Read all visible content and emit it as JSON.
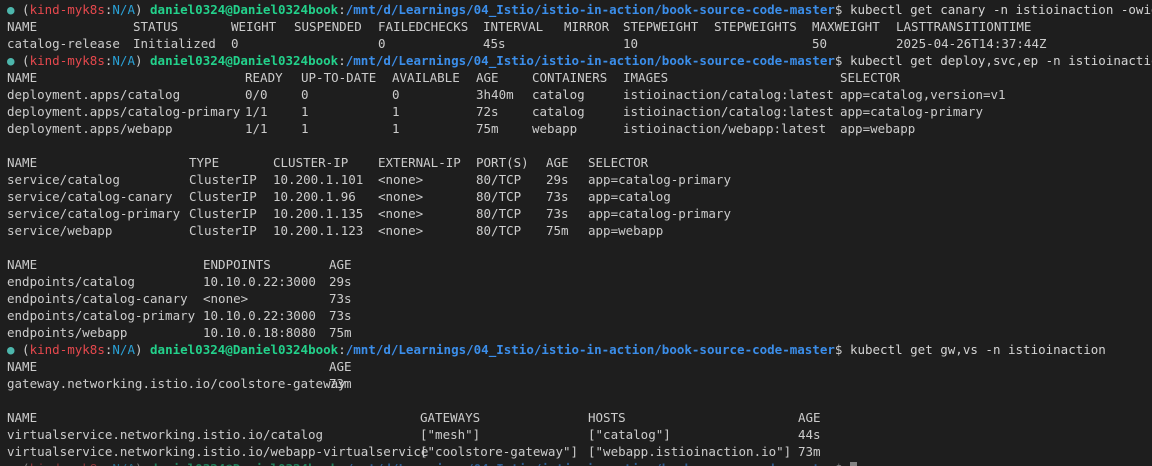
{
  "colors": {
    "background": "#1e1e1e",
    "text": "#cccccc",
    "prompt_dot": "#4db6ac",
    "context": "#e5484d",
    "namespace": "#2aa1d6",
    "user": "#23d18b",
    "path": "#3b8eea"
  },
  "prompt": {
    "dot": "●",
    "open": " (",
    "context": "kind-myk8s",
    "sep": ":",
    "namespace": "N/A",
    "close": ") ",
    "user": "daniel0324@Daniel0324book",
    "colon": ":",
    "path": "/mnt/d/Learnings/04_Istio/istio-in-action/book-source-code-master",
    "dollar": "$ "
  },
  "commands": [
    "kubectl get canary -n istioinaction -owide",
    "kubectl get deploy,svc,ep -n istioinaction -o wide",
    "kubectl get gw,vs -n istioinaction",
    ""
  ],
  "tables": [
    {
      "id": "canary",
      "header": [
        "NAME",
        "STATUS",
        "WEIGHT",
        "SUSPENDED",
        "FAILEDCHECKS",
        "INTERVAL",
        "MIRROR",
        "STEPWEIGHT",
        "STEPWEIGHTS",
        "MAXWEIGHT",
        "LASTTRANSITIONTIME"
      ],
      "rows": [
        [
          "catalog-release",
          "Initialized",
          "0",
          "",
          "0",
          "45s",
          "",
          "10",
          "",
          "50",
          "2025-04-26T14:37:44Z"
        ]
      ]
    },
    {
      "id": "deploy",
      "header": [
        "NAME",
        "READY",
        "UP-TO-DATE",
        "AVAILABLE",
        "AGE",
        "CONTAINERS",
        "IMAGES",
        "SELECTOR"
      ],
      "rows": [
        [
          "deployment.apps/catalog",
          "0/0",
          "0",
          "0",
          "3h40m",
          "catalog",
          "istioinaction/catalog:latest",
          "app=catalog,version=v1"
        ],
        [
          "deployment.apps/catalog-primary",
          "1/1",
          "1",
          "1",
          "72s",
          "catalog",
          "istioinaction/catalog:latest",
          "app=catalog-primary"
        ],
        [
          "deployment.apps/webapp",
          "1/1",
          "1",
          "1",
          "75m",
          "webapp",
          "istioinaction/webapp:latest",
          "app=webapp"
        ]
      ]
    },
    {
      "id": "svc",
      "header": [
        "NAME",
        "TYPE",
        "CLUSTER-IP",
        "EXTERNAL-IP",
        "PORT(S)",
        "AGE",
        "SELECTOR"
      ],
      "rows": [
        [
          "service/catalog",
          "ClusterIP",
          "10.200.1.101",
          "<none>",
          "80/TCP",
          "29s",
          "app=catalog-primary"
        ],
        [
          "service/catalog-canary",
          "ClusterIP",
          "10.200.1.96",
          "<none>",
          "80/TCP",
          "73s",
          "app=catalog"
        ],
        [
          "service/catalog-primary",
          "ClusterIP",
          "10.200.1.135",
          "<none>",
          "80/TCP",
          "73s",
          "app=catalog-primary"
        ],
        [
          "service/webapp",
          "ClusterIP",
          "10.200.1.123",
          "<none>",
          "80/TCP",
          "75m",
          "app=webapp"
        ]
      ]
    },
    {
      "id": "ep",
      "header": [
        "NAME",
        "ENDPOINTS",
        "AGE"
      ],
      "rows": [
        [
          "endpoints/catalog",
          "10.10.0.22:3000",
          "29s"
        ],
        [
          "endpoints/catalog-canary",
          "<none>",
          "73s"
        ],
        [
          "endpoints/catalog-primary",
          "10.10.0.22:3000",
          "73s"
        ],
        [
          "endpoints/webapp",
          "10.10.0.18:8080",
          "75m"
        ]
      ]
    },
    {
      "id": "gw",
      "header": [
        "NAME",
        "AGE"
      ],
      "rows": [
        [
          "gateway.networking.istio.io/coolstore-gateway",
          "73m"
        ]
      ]
    },
    {
      "id": "vs",
      "header": [
        "NAME",
        "GATEWAYS",
        "HOSTS",
        "AGE"
      ],
      "rows": [
        [
          "virtualservice.networking.istio.io/catalog",
          "[\"mesh\"]",
          "[\"catalog\"]",
          "44s"
        ],
        [
          "virtualservice.networking.istio.io/webapp-virtualservice",
          "[\"coolstore-gateway\"]",
          "[\"webapp.istioinaction.io\"]",
          "73m"
        ]
      ]
    }
  ]
}
